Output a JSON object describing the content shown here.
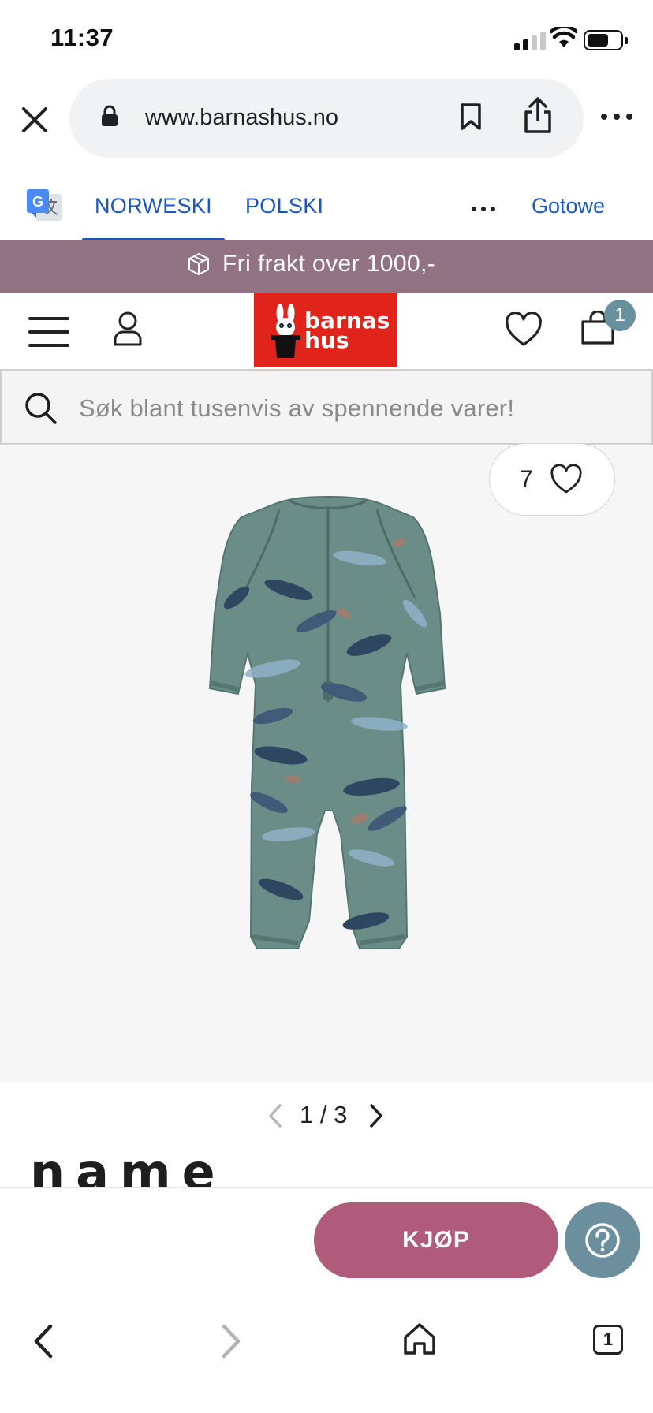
{
  "status_bar": {
    "time": "11:37"
  },
  "browser": {
    "url": "www.barnashus.no"
  },
  "translate_bar": {
    "languages": [
      {
        "label": "NORWESKI",
        "active": true
      },
      {
        "label": "POLSKI",
        "active": false
      }
    ],
    "done_label": "Gotowe"
  },
  "promo": {
    "text": "Fri frakt over 1000,-"
  },
  "header": {
    "logo_line1": "barnas",
    "logo_line2": "hus",
    "cart_count": "1"
  },
  "search": {
    "placeholder": "Søk blant tusenvis av spennende varer!"
  },
  "product": {
    "favorite_count": "7",
    "image_pager": {
      "current": "1",
      "separator": "/",
      "total": "3"
    },
    "brand": "name it"
  },
  "actions": {
    "buy_label": "KJØP"
  },
  "bottom_nav": {
    "tab_count": "1"
  },
  "colors": {
    "promo_bg": "#917384",
    "logo_red": "#e0231b",
    "buy_button": "#b05b7a",
    "help_button": "#6c8f9e",
    "link_blue": "#1a56c2",
    "garment": "#6b8d88"
  }
}
